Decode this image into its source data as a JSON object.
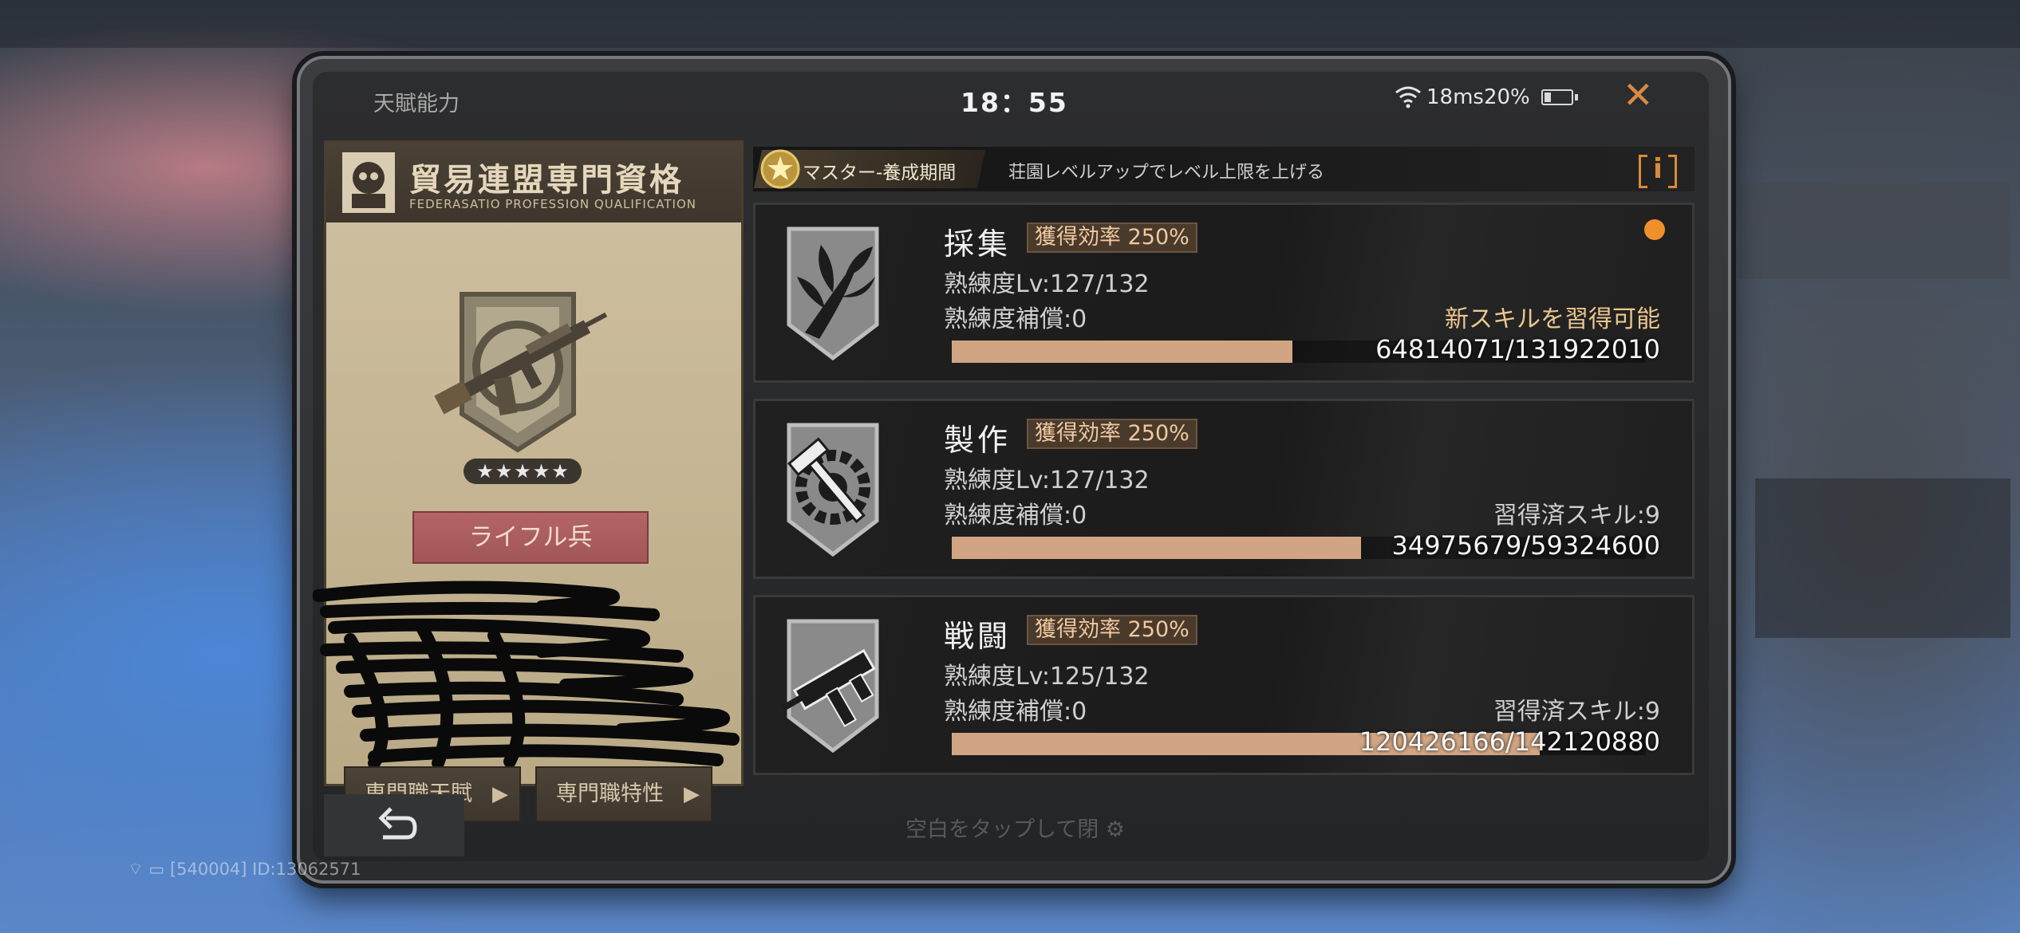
{
  "window": {
    "title": "天賦能力",
    "clock": "18：55",
    "ping": "18ms20%"
  },
  "card": {
    "title": "貿易連盟専門資格",
    "subtitle": "FEDERASATIO PROFESSION QUALIFICATION",
    "class_name": "ライフル兵",
    "stars": 5,
    "buttons": [
      "専門職天賦",
      "専門職特性"
    ],
    "icon": "assault-rifle-emblem"
  },
  "master": {
    "label": "マスター-養成期間",
    "description": "荘園レベルアップでレベル上限を上げる",
    "info_label": "i"
  },
  "skills": [
    {
      "name": "採集",
      "efficiency": "獲得効率 250%",
      "level": "熟練度Lv:127/132",
      "compensation": "熟練度補償:0",
      "status": "新スキルを習得可能",
      "progress_text": "64814071/131922010",
      "progress": 0.4913,
      "notification": true,
      "icon": "herb-icon"
    },
    {
      "name": "製作",
      "efficiency": "獲得効率 250%",
      "level": "熟練度Lv:127/132",
      "compensation": "熟練度補償:0",
      "status": "習得済スキル:9",
      "progress_text": "34975679/59324600",
      "progress": 0.5896,
      "notification": false,
      "icon": "hammer-gear-icon"
    },
    {
      "name": "戦闘",
      "efficiency": "獲得効率 250%",
      "level": "熟練度Lv:125/132",
      "compensation": "熟練度補償:0",
      "status": "習得済スキル:9",
      "progress_text": "120426166/142120880",
      "progress": 0.8473,
      "notification": false,
      "icon": "smg-icon"
    }
  ],
  "footer": {
    "hint": "空白をタップして閉",
    "net_info": "[540004] ID:13062571"
  },
  "colors": {
    "accent_orange": "#d88a45",
    "progress_fill": "#d1a583",
    "efficiency_text": "#f0c9a0",
    "new_skill_text": "#ecc78f"
  }
}
